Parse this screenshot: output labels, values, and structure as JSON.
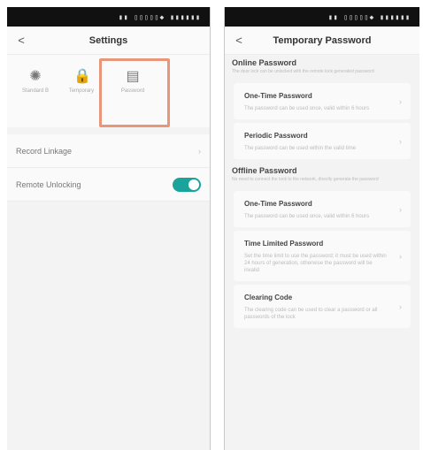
{
  "left": {
    "status": "▮▮ ▯▯▯▯▯◆ ▮▮▮▮▮▮",
    "title": "Settings",
    "back_glyph": "<",
    "tiles": [
      {
        "icon": "gear-icon",
        "glyph": "✺",
        "label": "Standard B"
      },
      {
        "icon": "lock-icon",
        "glyph": "🔒",
        "label": "Temporary"
      },
      {
        "icon": "document-icon",
        "glyph": "▤",
        "label": "Password"
      }
    ],
    "rows": [
      {
        "label": "Record Linkage",
        "control": "›"
      },
      {
        "label": "Remote Unlocking",
        "control": "toggle",
        "on": true
      }
    ],
    "accent": "#1aa39a",
    "highlight": "#e8967a"
  },
  "right": {
    "status": "▮▮ ▯▯▯▯▯◆ ▮▮▮▮▮▮",
    "title": "Temporary Password",
    "back_glyph": "<",
    "online": {
      "title": "Online Password",
      "desc": "The door lock can be unlocked with the remote lock generated password",
      "cards": [
        {
          "title": "One-Time Password",
          "desc": "The password can be used once, valid within 6 hours",
          "chev": "›"
        },
        {
          "title": "Periodic Password",
          "desc": "The password can be used within the valid time",
          "chev": "›"
        }
      ]
    },
    "offline": {
      "title": "Offline Password",
      "desc": "No need to connect the lock to the network, directly generate the password",
      "cards": [
        {
          "title": "One-Time Password",
          "desc": "The password can be used once, valid within 6 hours",
          "chev": "›"
        },
        {
          "title": "Time Limited Password",
          "desc": "Set the time limit to use the password; it must be used within 24 hours of generation, otherwise the password will be invalid",
          "chev": "›"
        },
        {
          "title": "Clearing Code",
          "desc": "The clearing code can be used to clear a password or all passwords of the lock",
          "chev": "›"
        }
      ]
    }
  }
}
